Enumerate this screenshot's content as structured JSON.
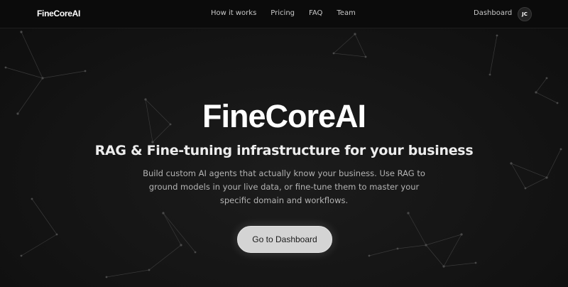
{
  "navbar": {
    "logo": "FineCoreAI",
    "links": [
      "How it works",
      "Pricing",
      "FAQ",
      "Team"
    ],
    "dashboard_link": "Dashboard",
    "avatar_initials": "JC"
  },
  "hero": {
    "title": "FineCoreAI",
    "subtitle": "RAG & Fine-tuning infrastructure for your business",
    "description": "Build custom AI agents that actually know your business. Use RAG to ground models in your live data, or fine-tune them to master your specific domain and workflows.",
    "cta_label": "Go to Dashboard"
  },
  "colors": {
    "background": "#121212",
    "navbar": "#0b0b0b",
    "cta_background": "#d4d4d4",
    "text_primary": "#ffffff",
    "text_secondary": "#b4b4b4"
  }
}
